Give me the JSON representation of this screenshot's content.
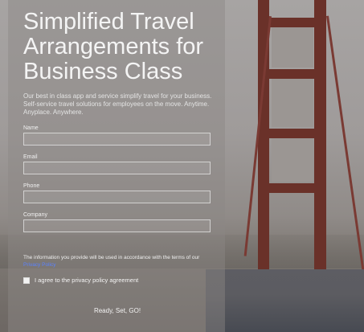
{
  "hero": {
    "headline": "Simplified Travel Arrangements for Business Class",
    "lede": "Our best in class app and service simplify travel for your business. Self-service travel solutions for employees on the move. Anytime. Anyplace. Anywhere."
  },
  "form": {
    "fields": [
      {
        "label": "Name",
        "value": ""
      },
      {
        "label": "Email",
        "value": ""
      },
      {
        "label": "Phone",
        "value": ""
      },
      {
        "label": "Company",
        "value": ""
      }
    ],
    "notice_text": "The information you provide will be used in accordance with the terms of our ",
    "notice_link": "Privacy Policy",
    "agree_label": "I agree to the privacy policy agreement",
    "submit_label": "Ready, Set, GO!"
  },
  "colors": {
    "bridge": "#6a3129",
    "link": "#5a82ff",
    "overlay": "#8c8886"
  }
}
